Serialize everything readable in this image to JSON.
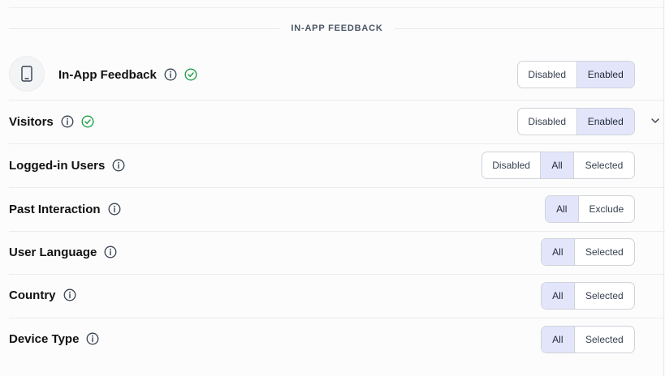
{
  "section": {
    "title": "IN-APP FEEDBACK"
  },
  "rows": [
    {
      "label": "In-App Feedback",
      "icon": "mobile-device-icon",
      "status": "check-circle-icon",
      "options": [
        "Disabled",
        "Enabled"
      ],
      "selected": "Enabled"
    },
    {
      "label": "Visitors",
      "status": "check-circle-icon",
      "options": [
        "Disabled",
        "Enabled"
      ],
      "selected": "Enabled",
      "expand_icon": "chevron-down-icon"
    },
    {
      "label": "Logged-in Users",
      "options": [
        "Disabled",
        "All",
        "Selected"
      ],
      "selected": "All"
    },
    {
      "label": "Past Interaction",
      "options": [
        "All",
        "Exclude"
      ],
      "selected": "All"
    },
    {
      "label": "User Language",
      "options": [
        "All",
        "Selected"
      ],
      "selected": "All"
    },
    {
      "label": "Country",
      "options": [
        "All",
        "Selected"
      ],
      "selected": "All"
    },
    {
      "label": "Device Type",
      "options": [
        "All",
        "Selected"
      ],
      "selected": "All"
    }
  ],
  "colors": {
    "active_segment": "#e3e6fb",
    "success_check": "#22a04b",
    "border": "#cfd3da"
  }
}
